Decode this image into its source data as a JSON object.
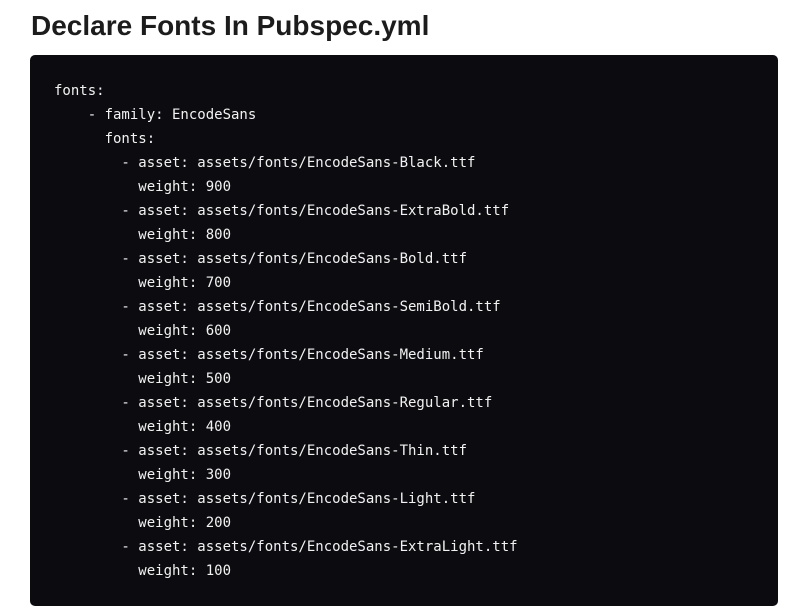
{
  "heading": "Declare Fonts In Pubspec.yml",
  "code": {
    "language": "yaml",
    "lines": [
      "fonts:",
      "    - family: EncodeSans",
      "      fonts:",
      "        - asset: assets/fonts/EncodeSans-Black.ttf",
      "          weight: 900",
      "        - asset: assets/fonts/EncodeSans-ExtraBold.ttf",
      "          weight: 800",
      "        - asset: assets/fonts/EncodeSans-Bold.ttf",
      "          weight: 700",
      "        - asset: assets/fonts/EncodeSans-SemiBold.ttf",
      "          weight: 600",
      "        - asset: assets/fonts/EncodeSans-Medium.ttf",
      "          weight: 500",
      "        - asset: assets/fonts/EncodeSans-Regular.ttf",
      "          weight: 400",
      "        - asset: assets/fonts/EncodeSans-Thin.ttf",
      "          weight: 300",
      "        - asset: assets/fonts/EncodeSans-Light.ttf",
      "          weight: 200",
      "        - asset: assets/fonts/EncodeSans-ExtraLight.ttf",
      "          weight: 100"
    ]
  },
  "colors": {
    "heading_text": "#1c1c1c",
    "code_background": "#0c0c10",
    "code_text": "#f2f2f2",
    "page_background": "#ffffff"
  }
}
